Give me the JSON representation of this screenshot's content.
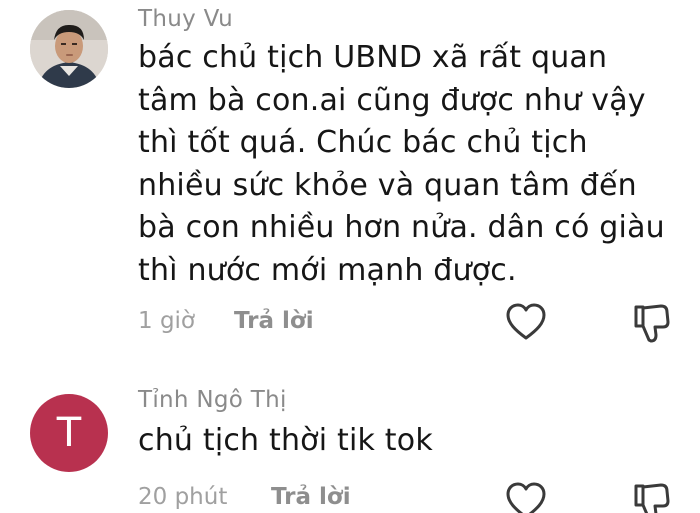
{
  "comments": [
    {
      "username": "Thuy Vu",
      "text_lines": [
        "bác chủ tịch UBND xã rất quan",
        "tâm bà con.ai cũng được như vậy",
        "thì tốt quá. Chúc bác chủ tịch",
        "nhiều sức khỏe và quan tâm đến",
        "bà con nhiều hơn nửa. dân có giàu",
        "thì nước mới mạnh được."
      ],
      "time": "1 giờ",
      "reply_label": "Trả lời",
      "avatar_icon": "profile-photo"
    },
    {
      "username": "Tỉnh Ngô Thị",
      "avatar_letter": "T",
      "avatar_color": "#b8314f",
      "text_lines": [
        "chủ tịch thời tik tok"
      ],
      "time": "20 phút",
      "reply_label": "Trả lời",
      "avatar_icon": "letter-avatar"
    }
  ],
  "icons": {
    "like": "heart-outline-icon",
    "dislike": "thumbs-down-outline-icon"
  }
}
